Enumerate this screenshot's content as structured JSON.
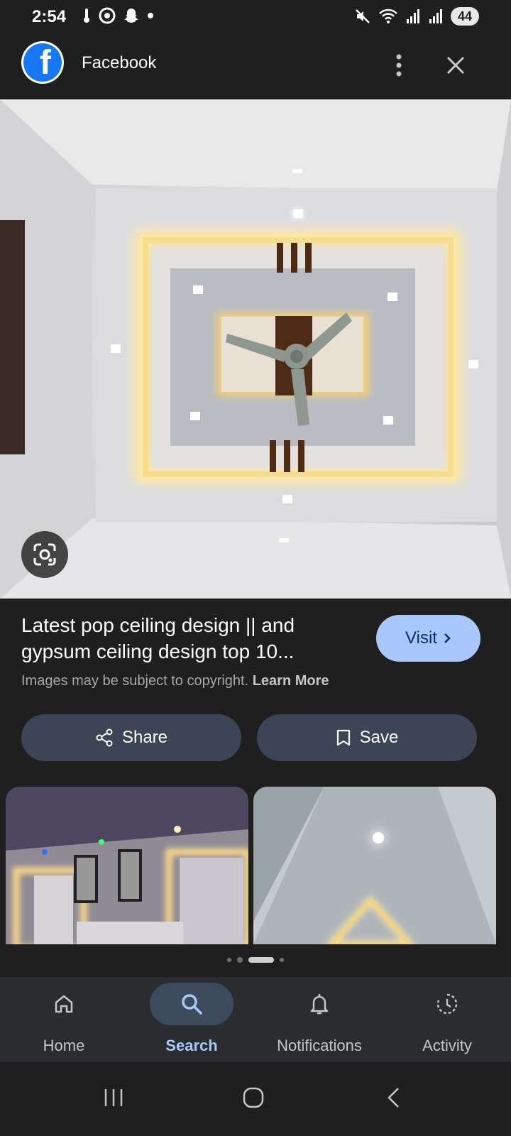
{
  "status_bar": {
    "time": "2:54",
    "battery": "44",
    "left_icons": [
      "thermometer-icon",
      "chrome-icon",
      "snapchat-icon",
      "dot-icon"
    ],
    "right_icons": [
      "mute-icon",
      "wifi-icon",
      "signal-icon",
      "signal-icon"
    ]
  },
  "header": {
    "app_name": "Facebook",
    "logo_letter": "f"
  },
  "result": {
    "title": "Latest pop ceiling design || and gypsum ceiling design top 10...",
    "visit_label": "Visit",
    "copyright_text": "Images may be subject to copyright.",
    "learn_more": "Learn More"
  },
  "actions": {
    "share_label": "Share",
    "save_label": "Save"
  },
  "nav": {
    "items": [
      {
        "label": "Home",
        "icon": "home-icon"
      },
      {
        "label": "Search",
        "icon": "search-icon",
        "active": true
      },
      {
        "label": "Notifications",
        "icon": "bell-icon"
      },
      {
        "label": "Activity",
        "icon": "activity-icon"
      }
    ]
  },
  "colors": {
    "accent": "#a8c7fa",
    "button_bg": "#3c4555",
    "facebook_blue": "#1877f2"
  }
}
